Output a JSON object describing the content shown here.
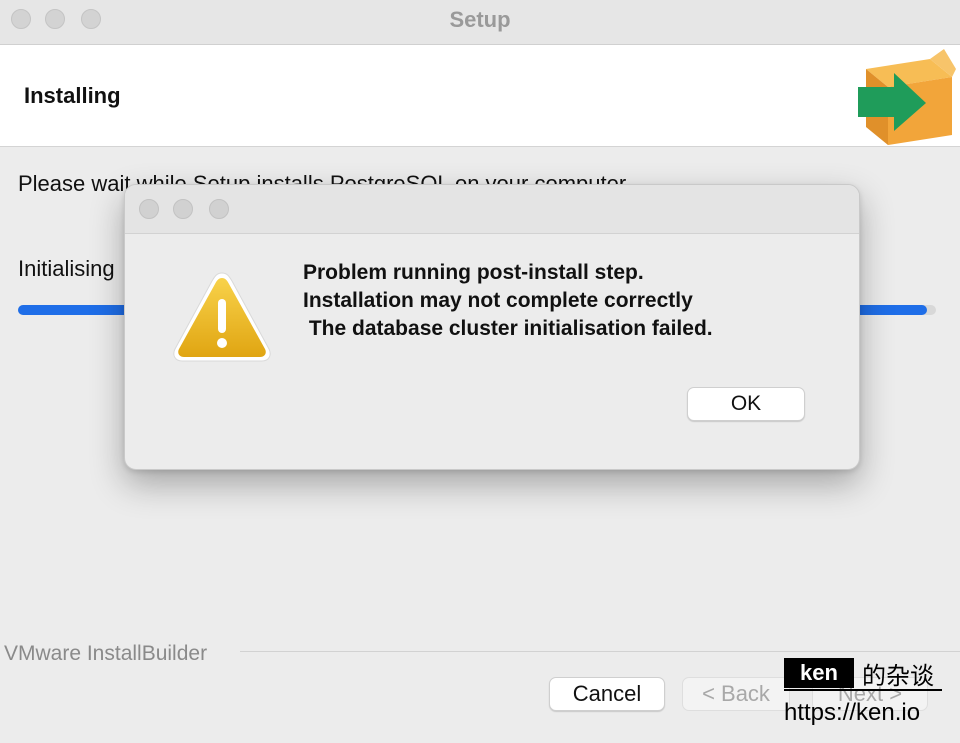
{
  "window": {
    "title": "Setup"
  },
  "header": {
    "title": "Installing",
    "icon": "installer-box-arrow-icon"
  },
  "main": {
    "wait_text": "Please wait while Setup installs PostgreSQL on your computer.",
    "status_text": "Initialising",
    "progress": 0.99
  },
  "footer": {
    "brand": "VMware InstallBuilder",
    "buttons": {
      "cancel": "Cancel",
      "back": "< Back",
      "next": "Next >"
    }
  },
  "watermark": {
    "name": "ken",
    "suffix": "的杂谈",
    "url": "https://ken.io"
  },
  "dialog": {
    "icon": "warning-icon",
    "message": "Problem running post-install step.\nInstallation may not complete correctly\n The database cluster initialisation failed.",
    "ok_label": "OK"
  },
  "colors": {
    "accent": "#1f6ee8",
    "warning": "#f0b81c",
    "box": "#f2a53a",
    "arrow": "#1f9c5a"
  }
}
